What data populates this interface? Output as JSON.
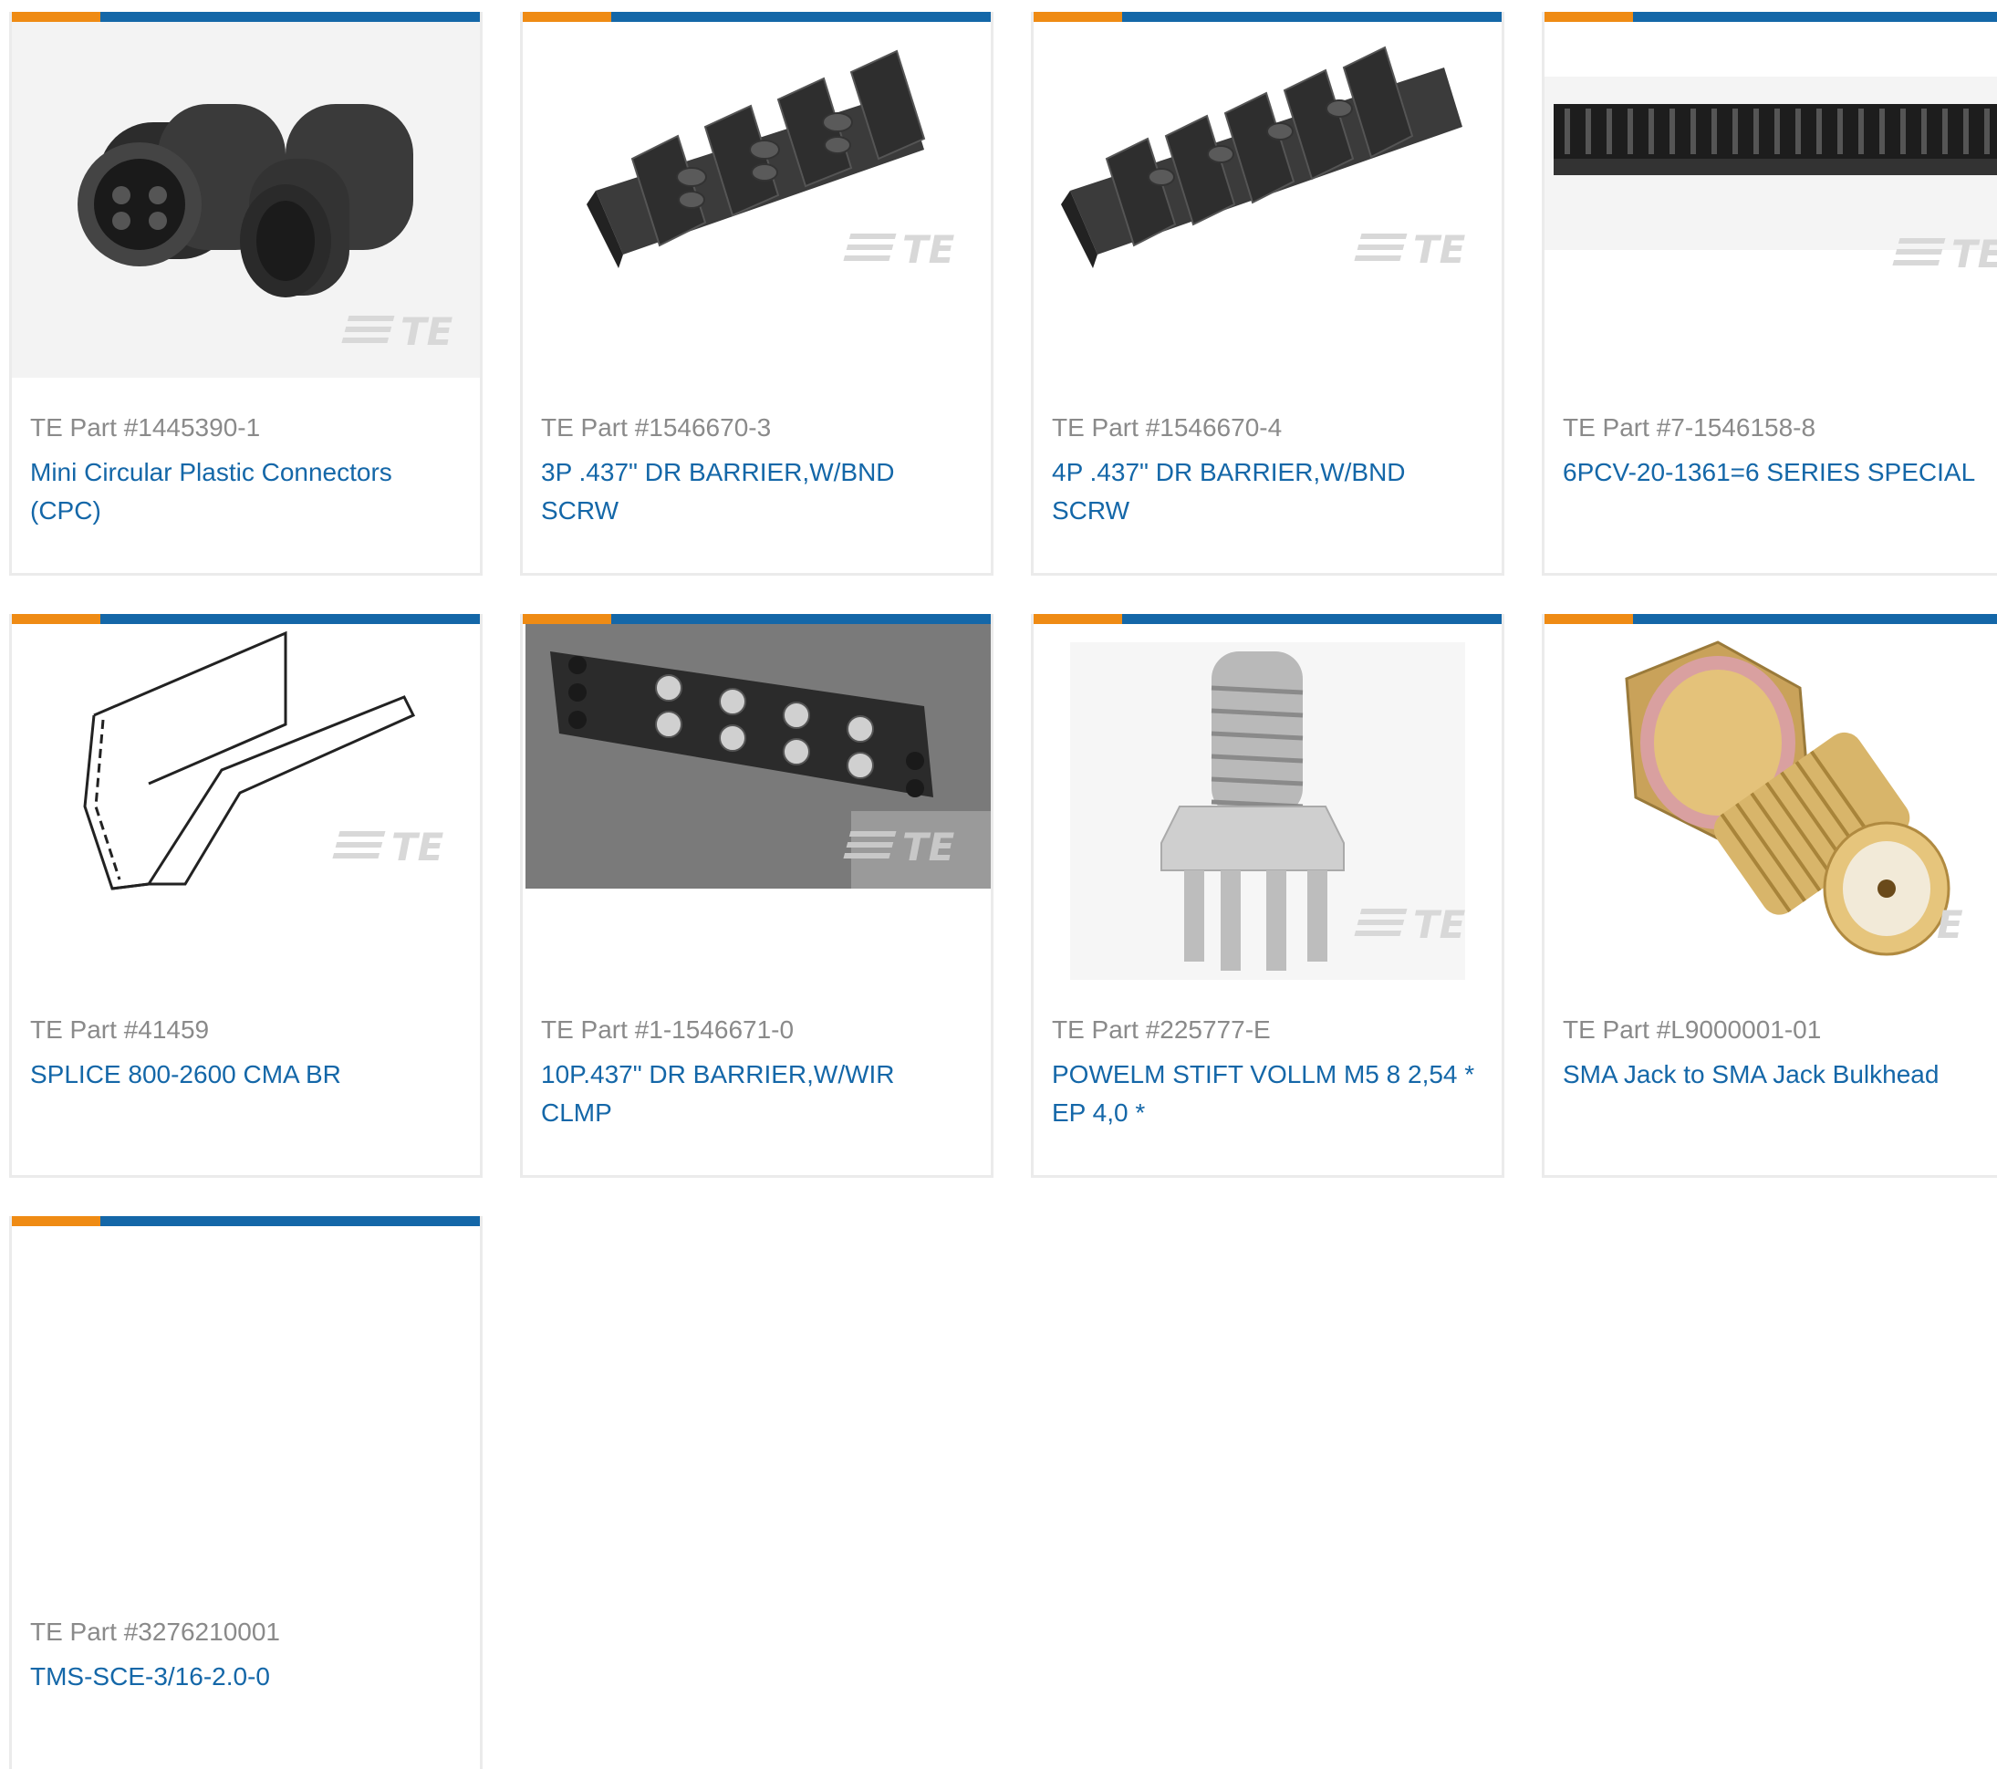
{
  "colors": {
    "accent_orange": "#ef8b14",
    "accent_blue": "#1467a8",
    "link": "#1467a8",
    "muted": "#8a8a8a",
    "border": "#ebebeb"
  },
  "products": [
    {
      "part_no": "TE Part #1445390-1",
      "name": "Mini Circular Plastic Connectors (CPC)",
      "image": "circular-connector-icon"
    },
    {
      "part_no": "TE Part #1546670-3",
      "name": "3P .437\" DR BARRIER,W/BND SCRW",
      "image": "barrier-terminal-block-icon"
    },
    {
      "part_no": "TE Part #1546670-4",
      "name": "4P .437\" DR BARRIER,W/BND SCRW",
      "image": "barrier-terminal-block-icon"
    },
    {
      "part_no": "TE Part #7-1546158-8",
      "name": "6PCV-20-1361=6 SERIES SPECIAL",
      "image": "pcb-terminal-strip-icon"
    },
    {
      "part_no": "TE Part #41459",
      "name": "SPLICE 800-2600 CMA BR",
      "image": "splice-drawing-icon"
    },
    {
      "part_no": "TE Part #1-1546671-0",
      "name": "10P.437\" DR BARRIER,W/WIR CLMP",
      "image": "terminal-block-photo-icon"
    },
    {
      "part_no": "TE Part #225777-E",
      "name": "POWELM STIFT VOLLM M5 8 2,54 * EP 4,0 *",
      "image": "threaded-stud-icon"
    },
    {
      "part_no": "TE Part #L9000001-01",
      "name": "SMA Jack to SMA Jack Bulkhead",
      "image": "sma-jack-icon"
    },
    {
      "part_no": "TE Part #3276210001",
      "name": "TMS-SCE-3/16-2.0-0",
      "image": ""
    }
  ]
}
